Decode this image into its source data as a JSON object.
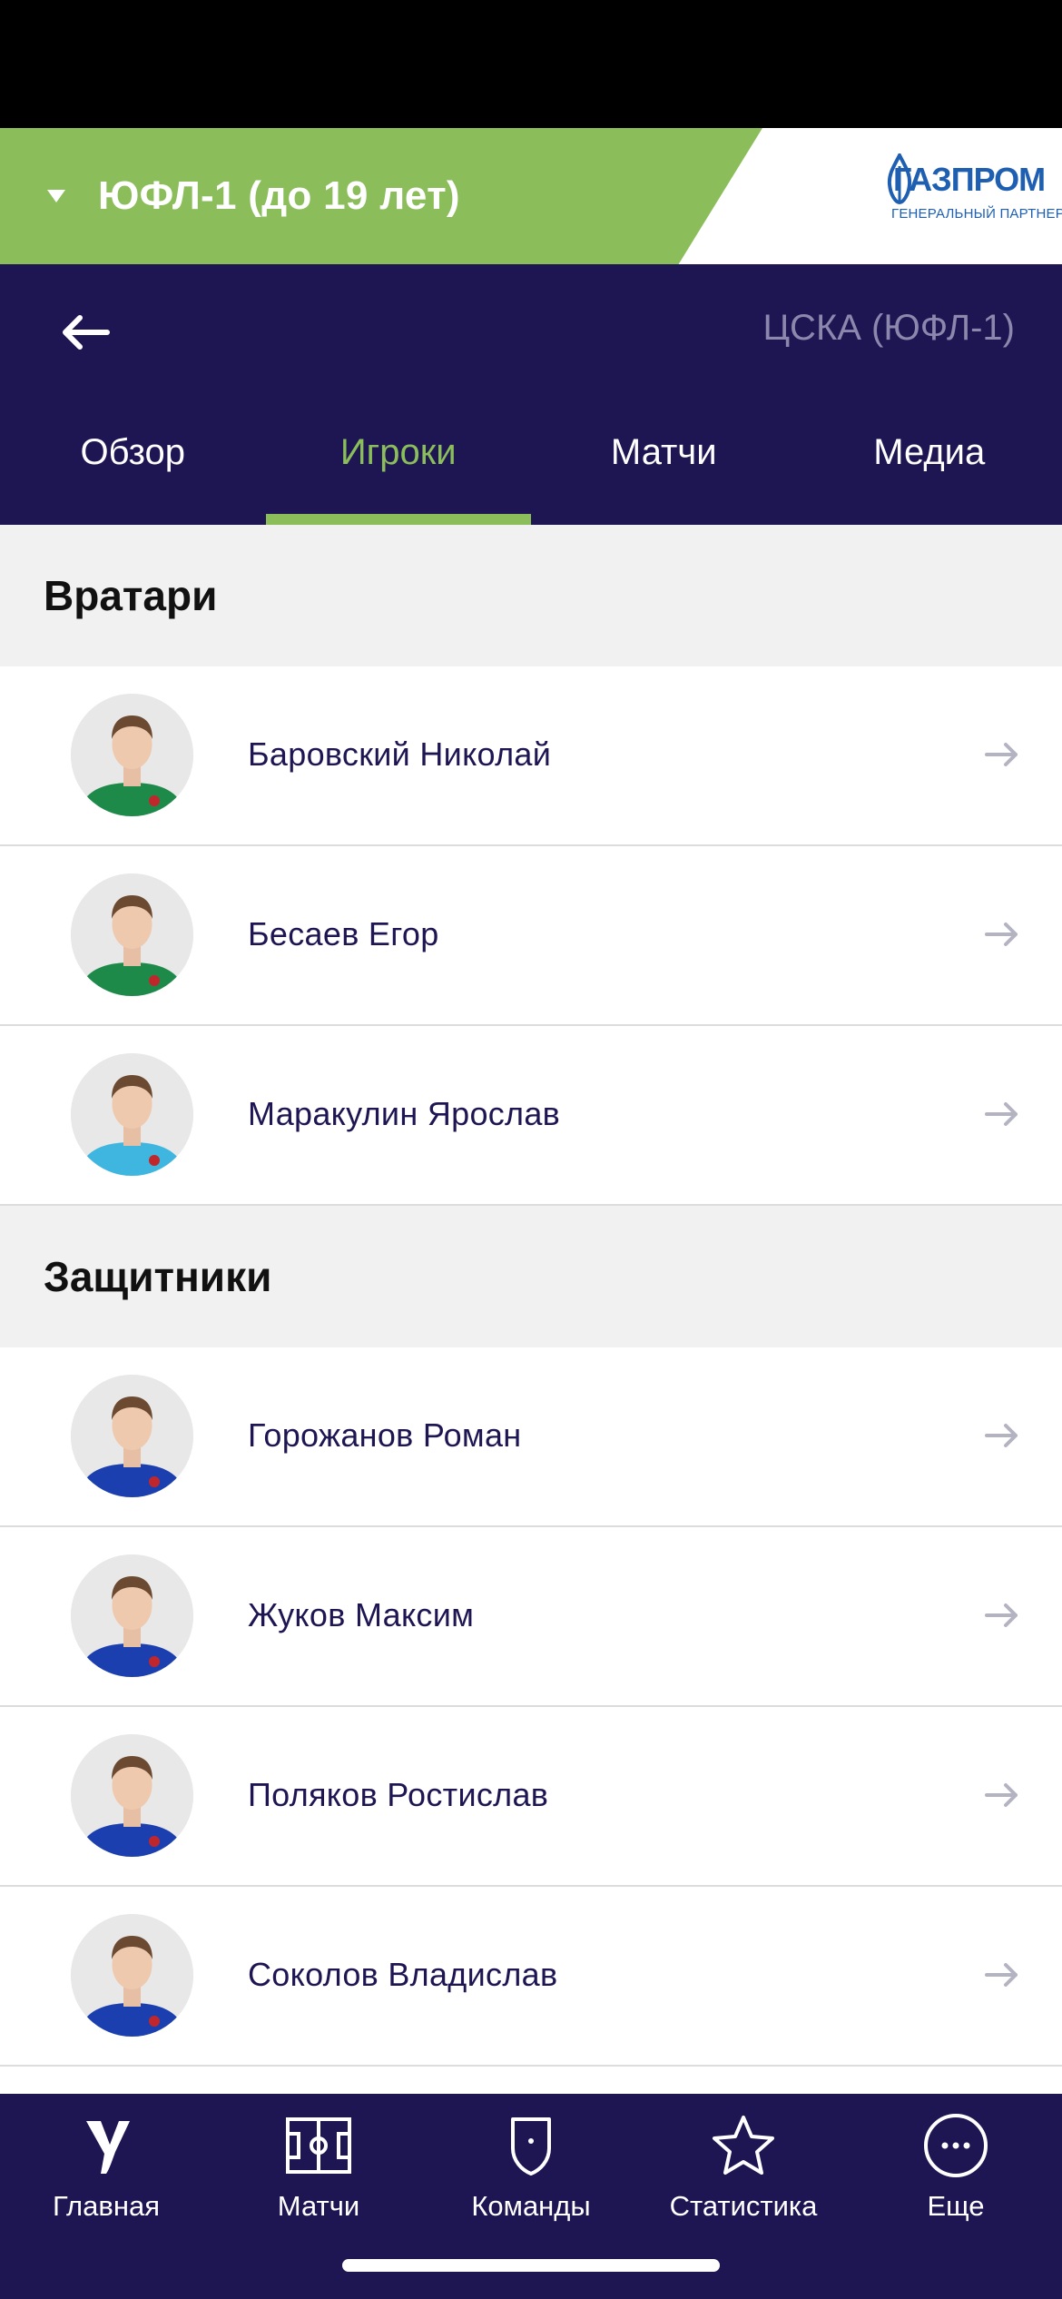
{
  "league": {
    "title": "ЮФЛ-1 (до 19 лет)"
  },
  "sponsor": {
    "name": "ГАЗПРОМ",
    "subtitle": "ГЕНЕРАЛЬНЫЙ ПАРТНЕР",
    "icon": "gazprom-flame-logo",
    "color": "#1f5fb2"
  },
  "team": {
    "name": "ЦСКА (ЮФЛ-1)"
  },
  "tabs": [
    {
      "label": "Обзор",
      "active": false
    },
    {
      "label": "Игроки",
      "active": true
    },
    {
      "label": "Матчи",
      "active": false
    },
    {
      "label": "Медиа",
      "active": false
    }
  ],
  "sections": [
    {
      "title": "Вратари",
      "players": [
        {
          "name": "Баровский Николай",
          "kit": "green"
        },
        {
          "name": "Бесаев Егор",
          "kit": "green"
        },
        {
          "name": "Маракулин Ярослав",
          "kit": "cyan"
        }
      ]
    },
    {
      "title": "Защитники",
      "players": [
        {
          "name": "Горожанов Роман",
          "kit": "blue"
        },
        {
          "name": "Жуков Максим",
          "kit": "blue"
        },
        {
          "name": "Поляков Ростислав",
          "kit": "blue"
        },
        {
          "name": "Соколов Владислав",
          "kit": "blue"
        }
      ]
    }
  ],
  "nav": [
    {
      "label": "Главная",
      "icon": "home-logo-icon"
    },
    {
      "label": "Матчи",
      "icon": "field-icon"
    },
    {
      "label": "Команды",
      "icon": "shield-icon"
    },
    {
      "label": "Статистика",
      "icon": "star-icon"
    },
    {
      "label": "Еще",
      "icon": "more-icon"
    }
  ],
  "colors": {
    "primary": "#1e1653",
    "accent": "#8bbe5b",
    "team_name": "#8c88ad",
    "section_bg": "#f1f1f1",
    "kits": {
      "green": "#1e8a4a",
      "cyan": "#3fb6e0",
      "blue": "#1c3fb0"
    }
  }
}
